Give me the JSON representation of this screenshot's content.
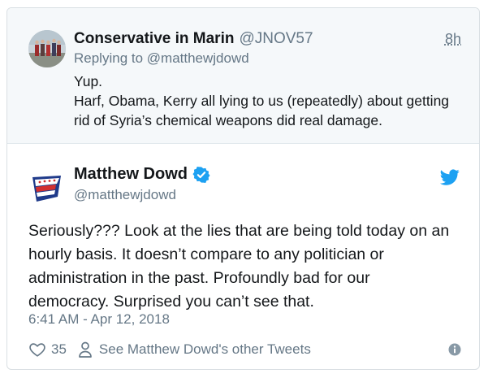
{
  "reply_tweet": {
    "author_name": "Conservative in Marin",
    "author_handle": "@JNOV57",
    "time": "8h",
    "replying_to": "Replying to @matthewjdowd",
    "text_lines": [
      "Yup.",
      "Harf, Obama, Kerry all lying to us (repeatedly) about getting",
      "rid of Syria’s chemical weapons did real damage."
    ]
  },
  "main_tweet": {
    "author_name": "Matthew Dowd",
    "author_handle": "@matthewjdowd",
    "verified_icon": "verified-badge-icon",
    "text_lines": [
      "Seriously??? Look at the lies that are being told today on an",
      "hourly basis.  It doesn’t compare to any politician or",
      "administration in the past.  Profoundly bad for our",
      "democracy.  Surprised you can’t see that."
    ],
    "timestamp": "6:41 AM - Apr 12, 2018"
  },
  "footer": {
    "like_count": "35",
    "see_others_label": "See Matthew Dowd's other Tweets"
  },
  "colors": {
    "accent": "#1da1f2",
    "text_primary": "#14171a",
    "text_secondary": "#657786",
    "reply_background": "#f5f8fa"
  }
}
